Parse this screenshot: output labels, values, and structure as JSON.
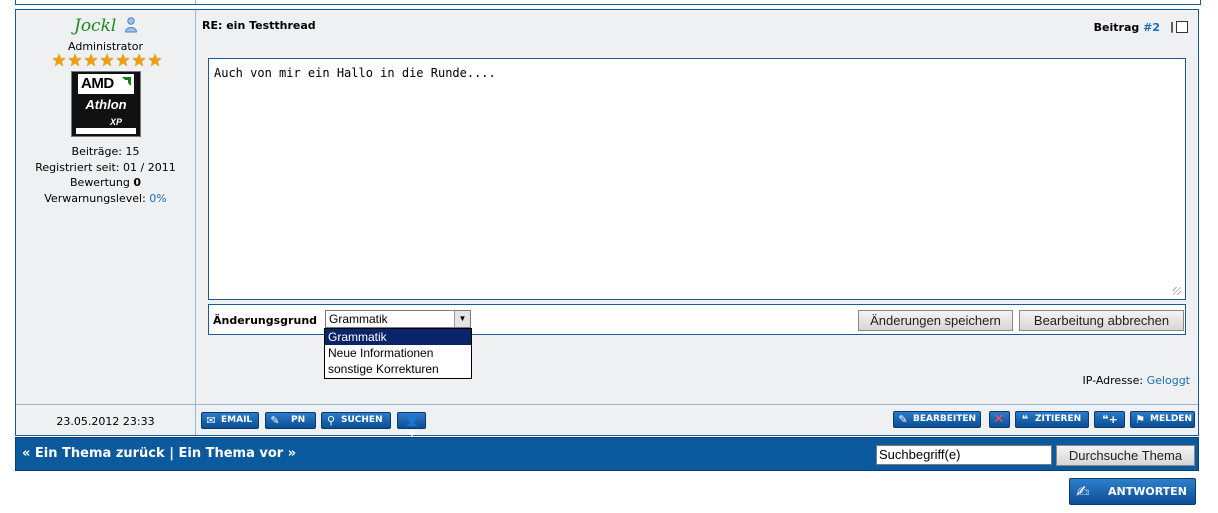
{
  "post": {
    "username": "Jockl",
    "rank": "Administrator",
    "stars_count": 7,
    "avatar": {
      "brand": "AMD",
      "model": "Athlon",
      "suffix": "XP"
    },
    "stats": {
      "posts_label": "Beiträge:",
      "posts_value": "15",
      "registered_label": "Registriert seit:",
      "registered_value": "01 / 2011",
      "rating_label": "Bewertung",
      "rating_value": "0",
      "warning_label": "Verwarnungslevel:",
      "warning_value": "0%"
    },
    "title": "RE: ein Testthread",
    "post_label": "Beitrag",
    "post_number": "#2",
    "separator": "|",
    "editor_text": "Auch von mir ein Hallo in die Runde....",
    "reason_label": "Änderungsgrund",
    "reason_selected": "Grammatik",
    "reason_options": [
      "Grammatik",
      "Neue Informationen",
      "sonstige Korrekturen"
    ],
    "save_label": "Änderungen speichern",
    "cancel_label": "Bearbeitung abbrechen",
    "ip_label": "IP-Adresse:",
    "ip_value": "Geloggt",
    "date": "23.05.2012 23:33"
  },
  "actions_left": {
    "email": "EMAIL",
    "pm": "PN",
    "search": "SUCHEN"
  },
  "actions_right": {
    "edit": "BEARBEITEN",
    "quote": "ZITIEREN",
    "report": "MELDEN"
  },
  "nav": {
    "prev_thread": "« Ein Thema zurück",
    "sep": "|",
    "next_thread": "Ein Thema vor »",
    "search_value": "Suchbegriff(e)",
    "search_button": "Durchsuche Thema"
  },
  "reply_button": "ANTWORTEN",
  "colors": {
    "accent": "#0b5a9e",
    "username": "#1b8c1b",
    "link": "#1b6fb5"
  }
}
